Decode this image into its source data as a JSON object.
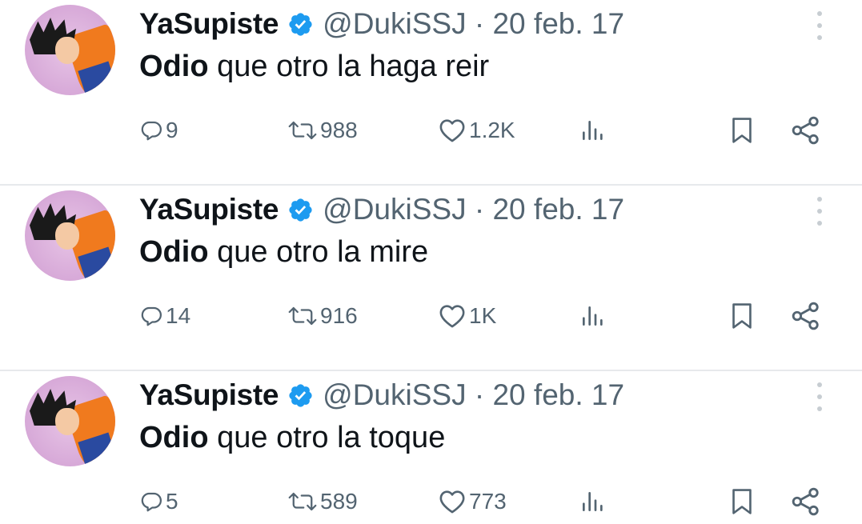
{
  "tweets": [
    {
      "author_name": "YaSupiste",
      "handle_date": "@DukiSSJ · 20 feb. 17",
      "text_bold": "Odio",
      "text_rest": " que otro la haga reir",
      "replies": "9",
      "retweets": "988",
      "likes": "1.2K"
    },
    {
      "author_name": "YaSupiste",
      "handle_date": "@DukiSSJ · 20 feb. 17",
      "text_bold": "Odio",
      "text_rest": " que otro la mire",
      "replies": "14",
      "retweets": "916",
      "likes": "1K"
    },
    {
      "author_name": "YaSupiste",
      "handle_date": "@DukiSSJ · 20 feb. 17",
      "text_bold": "Odio",
      "text_rest": " que otro la toque",
      "replies": "5",
      "retweets": "589",
      "likes": "773"
    }
  ],
  "colors": {
    "verified_badge": "#1d9bf0",
    "icon_gray": "#536471",
    "divider": "#e7e9ec"
  },
  "icons": [
    "verified-badge-icon",
    "more-icon",
    "reply-icon",
    "retweet-icon",
    "like-icon",
    "views-icon",
    "bookmark-icon",
    "share-icon"
  ]
}
